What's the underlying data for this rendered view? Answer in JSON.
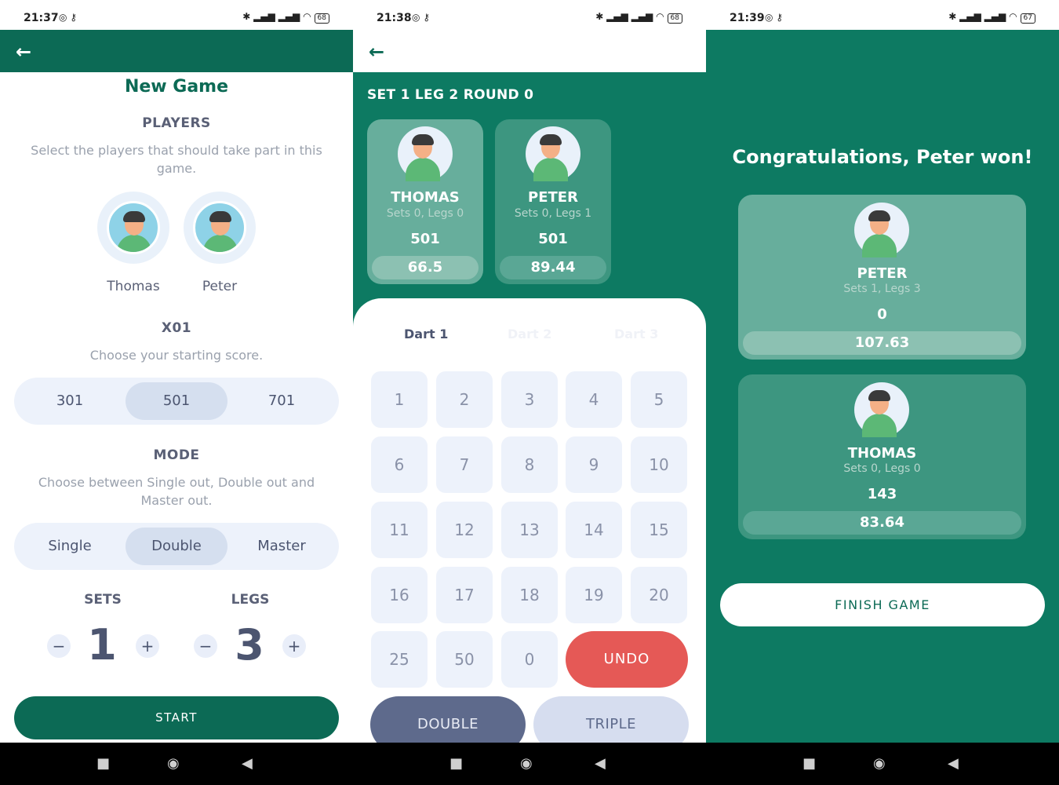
{
  "colors": {
    "primary": "#0c6a55",
    "teal_bg": "#0d7a62",
    "undo": "#e55956",
    "double": "#5e6a8c"
  },
  "screens": {
    "new_game": {
      "status": {
        "time": "21:37",
        "battery": "68"
      },
      "title": "New Game",
      "players_heading": "PLAYERS",
      "players_desc": "Select the players that should take part in this game.",
      "players": [
        {
          "name": "Thomas"
        },
        {
          "name": "Peter"
        }
      ],
      "x01_heading": "X01",
      "x01_desc": "Choose your starting score.",
      "score_options": [
        "301",
        "501",
        "701"
      ],
      "score_selected": "501",
      "mode_heading": "MODE",
      "mode_desc": "Choose between Single out, Double out and Master out.",
      "mode_options": [
        "Single",
        "Double",
        "Master"
      ],
      "mode_selected": "Double",
      "sets_label": "SETS",
      "sets_value": "1",
      "legs_label": "LEGS",
      "legs_value": "3",
      "minus": "−",
      "plus": "+",
      "start_label": "START"
    },
    "game": {
      "status": {
        "time": "21:38",
        "battery": "68"
      },
      "set_title": "SET 1 LEG 2 ROUND 0",
      "players": [
        {
          "name": "THOMAS",
          "sub": "Sets 0, Legs 0",
          "score": "501",
          "average": "66.5"
        },
        {
          "name": "PETER",
          "sub": "Sets 0, Legs 1",
          "score": "501",
          "average": "89.44"
        }
      ],
      "darts": [
        "Dart 1",
        "Dart 2",
        "Dart 3"
      ],
      "keys": [
        "1",
        "2",
        "3",
        "4",
        "5",
        "6",
        "7",
        "8",
        "9",
        "10",
        "11",
        "12",
        "13",
        "14",
        "15",
        "16",
        "17",
        "18",
        "19",
        "20",
        "25",
        "50",
        "0"
      ],
      "undo_label": "UNDO",
      "double_label": "DOUBLE",
      "triple_label": "TRIPLE"
    },
    "result": {
      "status": {
        "time": "21:39",
        "battery": "67"
      },
      "congrats": "Congratulations, Peter won!",
      "players": [
        {
          "name": "PETER",
          "sub": "Sets 1, Legs 3",
          "score": "0",
          "average": "107.63"
        },
        {
          "name": "THOMAS",
          "sub": "Sets 0, Legs 0",
          "score": "143",
          "average": "83.64"
        }
      ],
      "finish_label": "FINISH GAME"
    }
  }
}
